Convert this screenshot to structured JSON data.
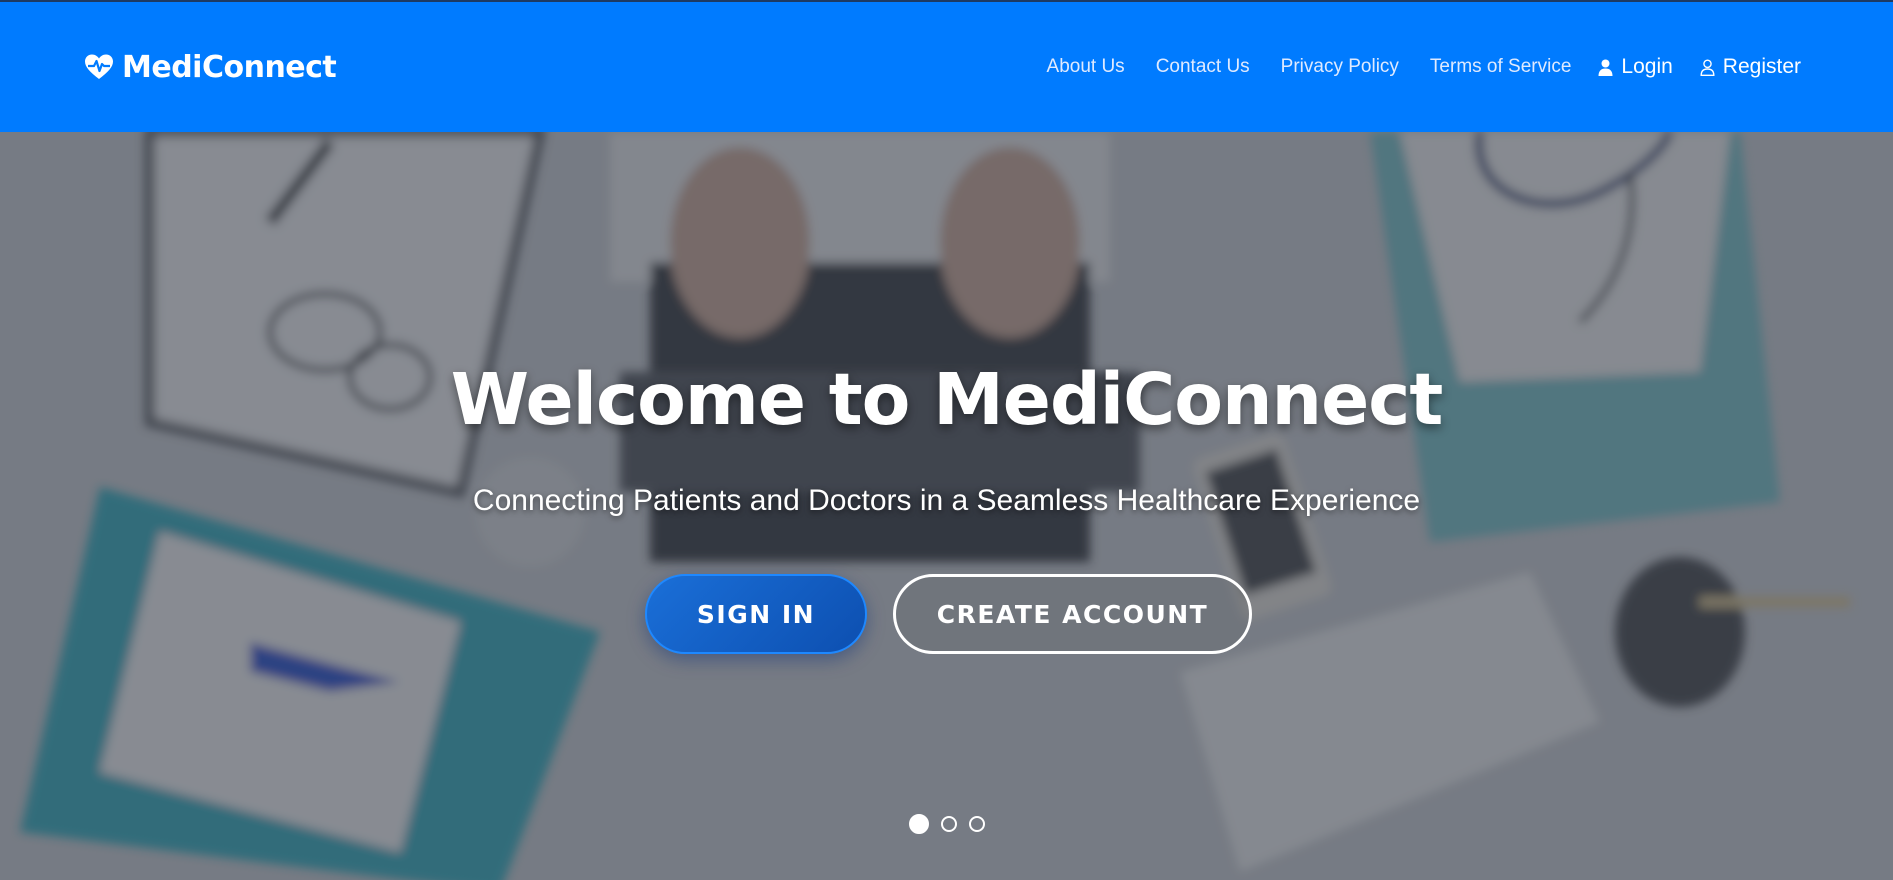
{
  "brand": {
    "name": "MediConnect",
    "icon": "heartbeat-icon"
  },
  "nav": {
    "links": [
      "About Us",
      "Contact Us",
      "Privacy Policy",
      "Terms of Service"
    ],
    "login_label": "Login",
    "register_label": "Register"
  },
  "hero": {
    "title": "Welcome to MediConnect",
    "subtitle": "Connecting Patients and Doctors in a Seamless Healthcare Experience",
    "signin_label": "SIGN IN",
    "create_label": "CREATE ACCOUNT",
    "slides_total": 3,
    "active_slide": 1
  },
  "colors": {
    "primary": "#007bff",
    "nav_text": "#dfeaff",
    "overlay": "#3a3f4a"
  }
}
